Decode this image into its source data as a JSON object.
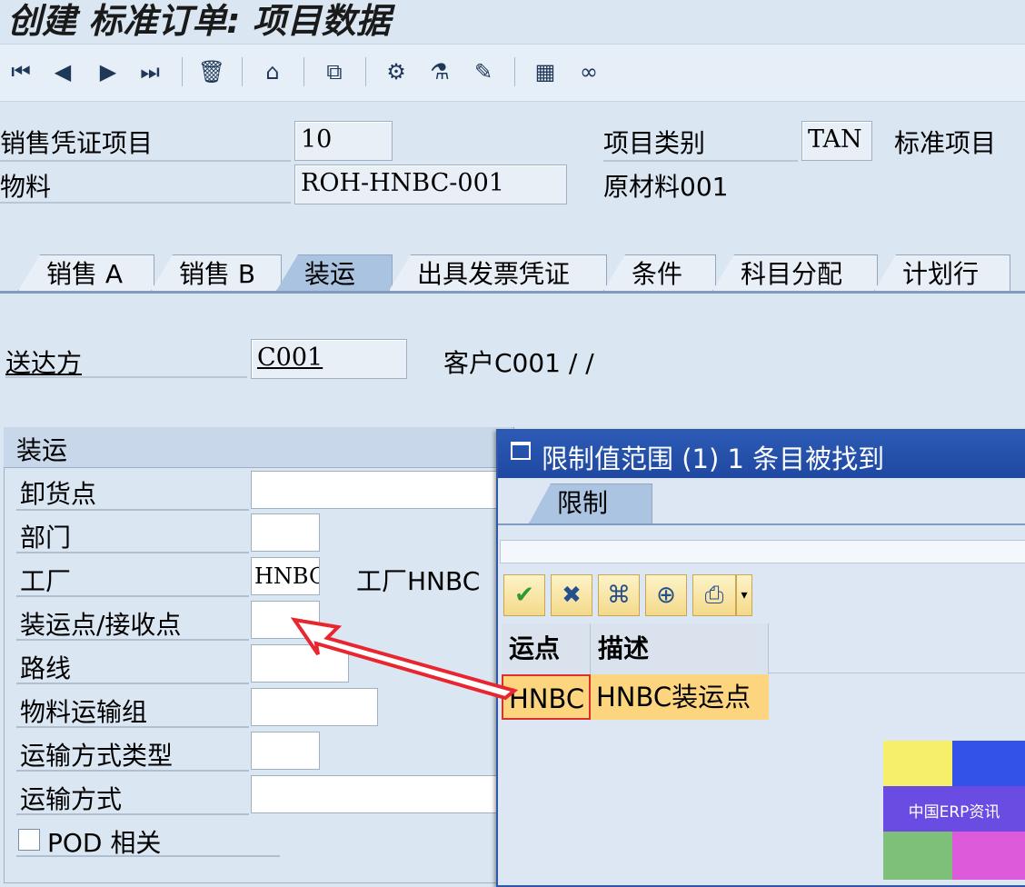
{
  "window": {
    "title": "创建 标准订单: 项目数据"
  },
  "toolbar": {
    "buttons": [
      {
        "name": "first-item-icon",
        "glyph": "⏮"
      },
      {
        "name": "previous-item-icon",
        "glyph": "◀"
      },
      {
        "name": "next-item-icon",
        "glyph": "▶"
      },
      {
        "name": "last-item-icon",
        "glyph": "⏭"
      },
      {
        "name": "delete-icon",
        "glyph": "🗑"
      },
      {
        "name": "header-icon",
        "glyph": "⌂"
      },
      {
        "name": "display-doc-flow-icon",
        "glyph": "⧉"
      },
      {
        "name": "configuration-icon",
        "glyph": "⚙"
      },
      {
        "name": "batch-icon",
        "glyph": "⚗"
      },
      {
        "name": "edit-notes-icon",
        "glyph": "✎"
      },
      {
        "name": "calculator-icon",
        "glyph": "▦"
      },
      {
        "name": "glasses-icon",
        "glyph": "∞"
      }
    ]
  },
  "header": {
    "sales_doc_item_label": "销售凭证项目",
    "sales_doc_item_value": "10",
    "item_category_label": "项目类别",
    "item_category_value": "TAN",
    "item_category_desc": "标准项目",
    "material_label": "物料",
    "material_value": "ROH-HNBC-001",
    "material_desc": "原材料001"
  },
  "tabs": [
    "销售 A",
    "销售 B",
    "装运",
    "出具发票凭证",
    "条件",
    "科目分配",
    "计划行"
  ],
  "ship_to": {
    "label": "送达方",
    "value": "C001",
    "desc": "客户C001 / /"
  },
  "shipping_group": {
    "title": "装运",
    "fields": {
      "unloading_point": "卸货点",
      "department": "部门",
      "plant": "工厂",
      "plant_value": "HNBC",
      "plant_desc": "工厂HNBC",
      "shipping_point": "装运点/接收点",
      "route": "路线",
      "material_freight_group": "物料运输组",
      "shipping_type_type": "运输方式类型",
      "shipping_type": "运输方式",
      "pod_relevant": "POD 相关"
    }
  },
  "popup": {
    "title": "限制值范围 (1)    1 条目被找到",
    "tab": "限制",
    "columns": [
      "运点",
      "描述"
    ],
    "rows": [
      {
        "code": "HNBC",
        "desc": "HNBC装运点"
      }
    ]
  },
  "watermark": {
    "text": "中国ERP资讯"
  },
  "colors": {
    "background": "#dbe6f3",
    "popup_title": "#2c5bb5",
    "selected_row": "#fdd57f",
    "arrow": "#e8262f"
  }
}
